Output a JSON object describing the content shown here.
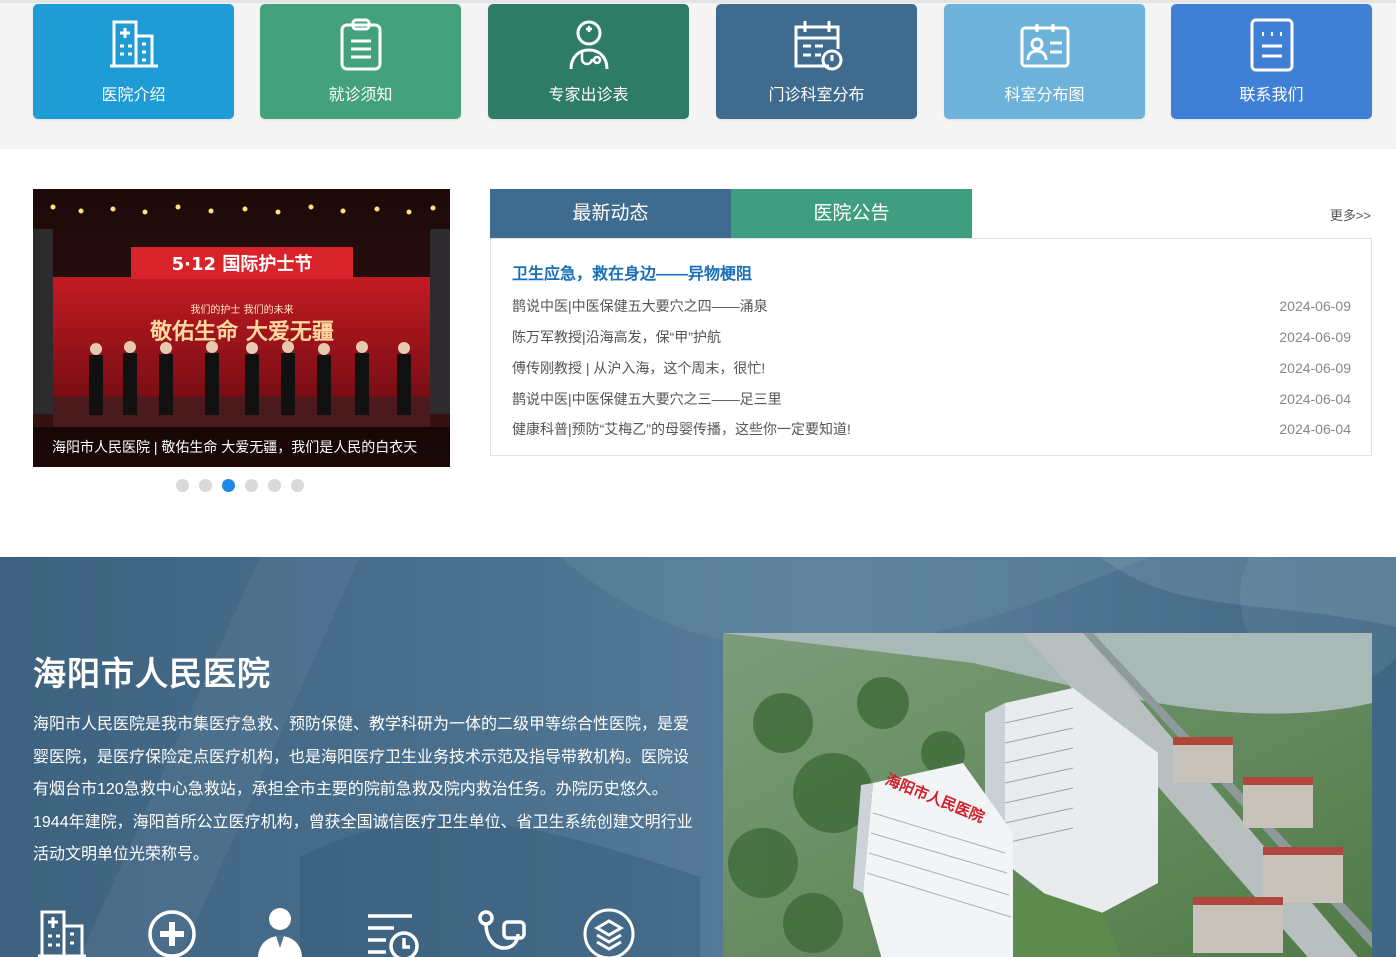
{
  "quick_links": [
    {
      "label": "医院介绍",
      "icon": "hospital-building-icon",
      "color": "#1f9bd6"
    },
    {
      "label": "就诊须知",
      "icon": "clipboard-icon",
      "color": "#43a27d"
    },
    {
      "label": "专家出诊表",
      "icon": "doctor-icon",
      "color": "#2e7b66"
    },
    {
      "label": "门诊科室分布",
      "icon": "calendar-clock-icon",
      "color": "#3e6b8e"
    },
    {
      "label": "科室分布图",
      "icon": "id-card-icon",
      "color": "#6cb2d9"
    },
    {
      "label": "联系我们",
      "icon": "contact-card-icon",
      "color": "#3f7fd6"
    }
  ],
  "slider": {
    "caption": "海阳市人民医院 | 敬佑生命 大爱无疆，我们是人民的白衣天",
    "banner_title": "5·12 国际护士节",
    "banner_subtitle": "我们的护士 我们的未来",
    "banner_slogan": "敬佑生命 大爱无疆",
    "dot_count": 6,
    "active_dot": 2
  },
  "news": {
    "tabs": [
      {
        "label": "最新动态",
        "color": "#3e6b8e"
      },
      {
        "label": "医院公告",
        "color": "#3f9e80"
      }
    ],
    "more_label": "更多>>",
    "headline": "卫生应急，救在身边——异物梗阻",
    "items": [
      {
        "title": "鹊说中医|中医保健五大要穴之四——涌泉",
        "date": "2024-06-09"
      },
      {
        "title": "陈万军教授|沿海高发，保“甲”护航",
        "date": "2024-06-09"
      },
      {
        "title": "傅传刚教授 | 从沪入海，这个周末，很忙!",
        "date": "2024-06-09"
      },
      {
        "title": "鹊说中医|中医保健五大要穴之三——足三里",
        "date": "2024-06-04"
      },
      {
        "title": "健康科普|预防“艾梅乙”的母婴传播，这些你一定要知道!",
        "date": "2024-06-04"
      }
    ]
  },
  "intro": {
    "title": "海阳市人民医院",
    "text": "海阳市人民医院是我市集医疗急救、预防保健、教学科研为一体的二级甲等综合性医院，是爱婴医院，是医疗保险定点医疗机构，也是海阳医疗卫生业务技术示范及指导带教机构。医院设有烟台市120急救中心急救站，承担全市主要的院前急救及院内救治任务。办院历史悠久。1944年建院，海阳首所公立医疗机构，曾获全国诚信医疗卫生单位、省卫生系统创建文明行业活动文明单位光荣称号。",
    "building_sign": "海阳市人民医院",
    "icons": [
      "hospital-icon",
      "medical-cross-icon",
      "doctor-icon",
      "schedule-icon",
      "stethoscope-icon",
      "layers-icon"
    ]
  }
}
